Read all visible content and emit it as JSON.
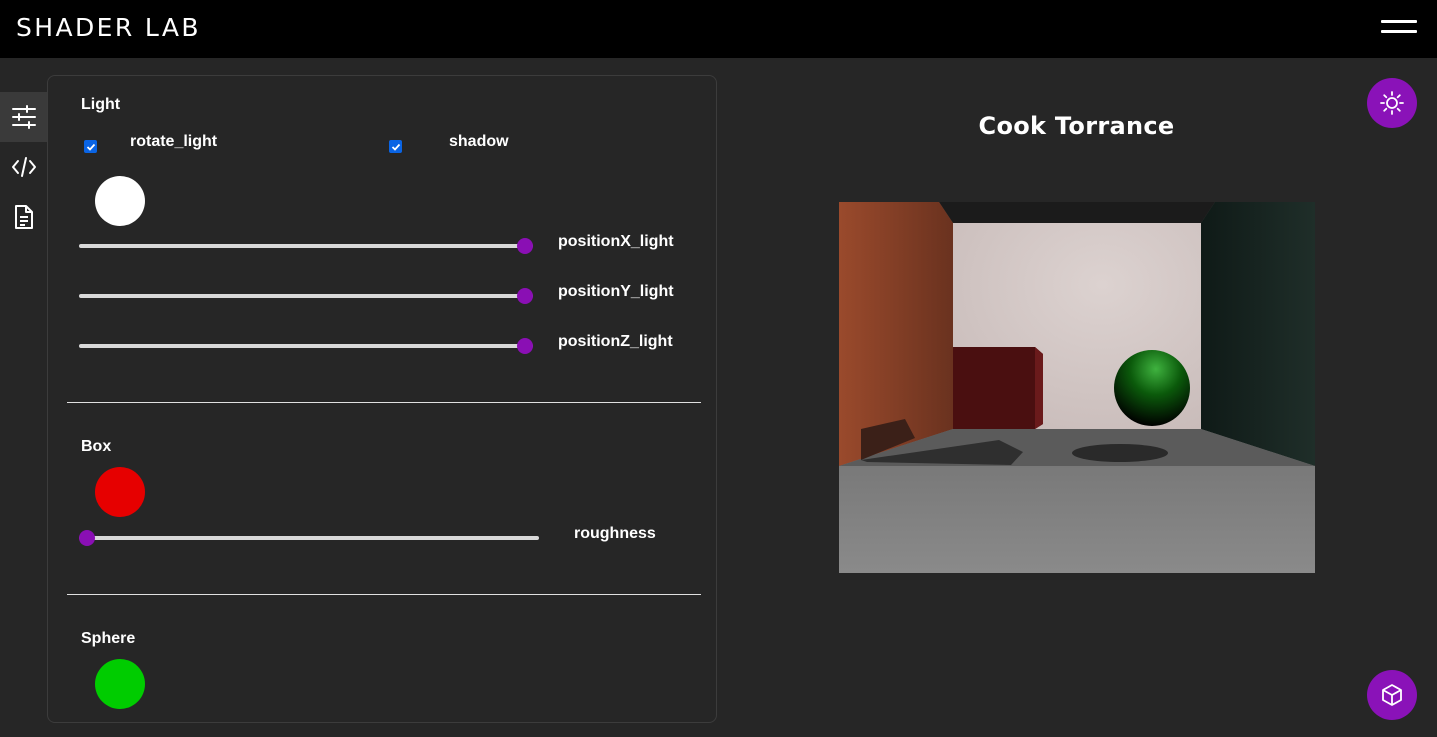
{
  "app": {
    "logo": "SHADER LAB"
  },
  "sidebar": {
    "items": [
      {
        "icon": "sliders-icon",
        "active": true
      },
      {
        "icon": "code-icon",
        "active": false
      },
      {
        "icon": "document-icon",
        "active": false
      }
    ]
  },
  "controls": {
    "light": {
      "title": "Light",
      "rotate_light": {
        "label": "rotate_light",
        "checked": true
      },
      "shadow": {
        "label": "shadow",
        "checked": true
      },
      "color": "#ffffff",
      "positionX": {
        "label": "positionX_light",
        "value_fraction": 1.0
      },
      "positionY": {
        "label": "positionY_light",
        "value_fraction": 1.0
      },
      "positionZ": {
        "label": "positionZ_light",
        "value_fraction": 1.0
      }
    },
    "box": {
      "title": "Box",
      "color": "#e60000",
      "roughness": {
        "label": "roughness",
        "value_fraction": 0.0
      }
    },
    "sphere": {
      "title": "Sphere",
      "color": "#00cc00"
    }
  },
  "scene": {
    "title": "Cook Torrance"
  },
  "colors": {
    "accent": "#8a12b8",
    "background": "#262626",
    "topbar": "#000000"
  },
  "fabs": {
    "top": "sun-icon",
    "bottom": "cube-icon"
  }
}
